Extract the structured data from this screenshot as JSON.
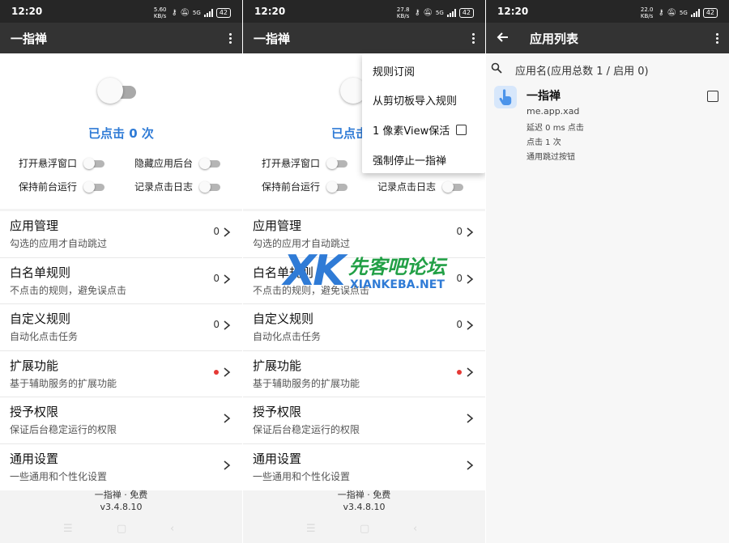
{
  "status": {
    "time": "12:20",
    "net_speed": [
      "5.60 KB/s",
      "27.8 KB/s",
      "22.0 KB/s"
    ],
    "network": "5G",
    "battery": "42"
  },
  "app_title": "一指禅",
  "main": {
    "toggle_state": "off",
    "clicked_text": "已点击 0 次",
    "options": [
      {
        "label": "打开悬浮窗口",
        "state": "off"
      },
      {
        "label": "隐藏应用后台",
        "state": "off"
      },
      {
        "label": "保持前台运行",
        "state": "off"
      },
      {
        "label": "记录点击日志",
        "state": "off"
      }
    ],
    "items": [
      {
        "name": "应用管理",
        "desc": "勾选的应用才自动跳过",
        "count": "0"
      },
      {
        "name": "白名单规则",
        "desc": "不点击的规则，避免误点击",
        "count": "0"
      },
      {
        "name": "自定义规则",
        "desc": "自动化点击任务",
        "count": "0"
      },
      {
        "name": "扩展功能",
        "desc": "基于辅助服务的扩展功能",
        "badge": "dot"
      },
      {
        "name": "授予权限",
        "desc": "保证后台稳定运行的权限"
      },
      {
        "name": "通用设置",
        "desc": "一些通用和个性化设置"
      }
    ],
    "footer_line1": "一指禅 · 免费",
    "footer_line2": "v3.4.8.10"
  },
  "overflow_menu": {
    "items": [
      "规则订阅",
      "从剪切板导入规则",
      "1 像素View保活",
      "强制停止一指禅"
    ],
    "checkbox_item_checked": false
  },
  "watermark": {
    "mark": "XK",
    "cn": "先客吧论坛",
    "en": "XIANKEBA.NET"
  },
  "app_list": {
    "title": "应用列表",
    "search_text": "应用名(应用总数 1 / 启用 0)",
    "apps": [
      {
        "name": "一指禅",
        "package": "me.app.xad",
        "delay": "延迟 0 ms 点击",
        "clicks": "点击 1 次",
        "rule": "通用跳过按钮",
        "checked": false
      }
    ]
  },
  "colors": {
    "accent": "#2f7bd6",
    "appbar": "#333333",
    "statusbar": "#262626",
    "badge_red": "#e53935"
  }
}
